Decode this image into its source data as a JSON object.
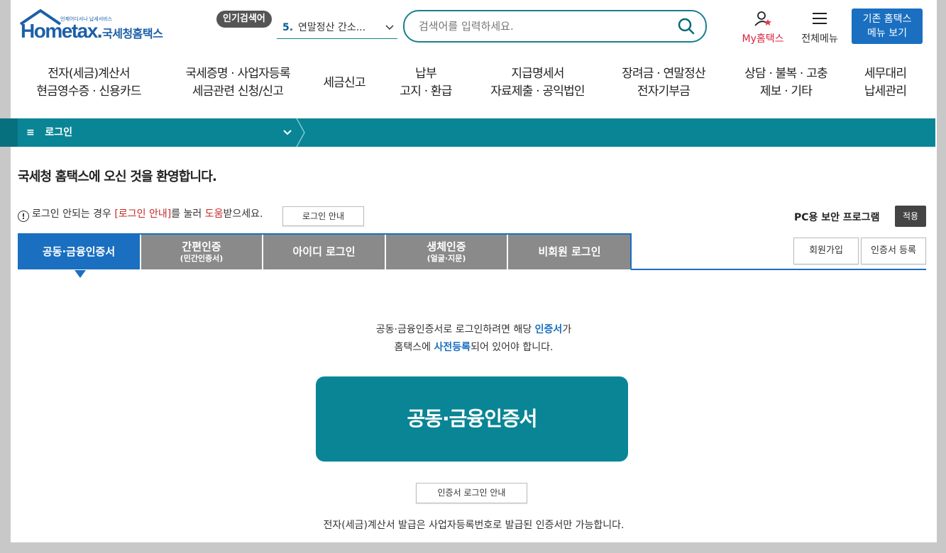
{
  "header": {
    "logo_small": "언제어디서나 납세서비스",
    "logo_brand": "Hometax.",
    "logo_kr": "국세청홈택스",
    "popular_badge": "인기검색어",
    "popular_num": "5.",
    "popular_text": "연말정산 간소...",
    "search_placeholder": "검색어를 입력하세요.",
    "my_label": "My홈택스",
    "all_menu_label": "전체메뉴",
    "old_btn_line1": "기존 홈택스",
    "old_btn_line2": "메뉴 보기"
  },
  "gnb": [
    {
      "l1": "전자(세금)계산서",
      "l2": "현금영수증 · 신용카드"
    },
    {
      "l1": "국세증명 · 사업자등록",
      "l2": "세금관련 신청/신고"
    },
    {
      "l1": "세금신고",
      "l2": ""
    },
    {
      "l1": "납부",
      "l2": "고지 · 환급"
    },
    {
      "l1": "지급명세서",
      "l2": "자료제출 · 공익법인"
    },
    {
      "l1": "장려금 · 연말정산",
      "l2": "전자기부금"
    },
    {
      "l1": "상담 · 불복 · 고충",
      "l2": "제보 · 기타"
    },
    {
      "l1": "세무대리",
      "l2": "납세관리"
    }
  ],
  "bar": {
    "crumb": "로그인"
  },
  "content": {
    "welcome": "국세청 홈택스에 오신 것을 환영합니다.",
    "help_pre": "로그인 안되는 경우 ",
    "help_red1": "[로그인 안내]",
    "help_mid": "를 눌러 ",
    "help_red2": "도움",
    "help_post": "받으세요.",
    "guide_btn": "로그인 안내",
    "pc_label": "PC용 보안 프로그램",
    "apply_btn": "적용",
    "tabs": [
      {
        "t1": "공동·금융인증서",
        "t2": ""
      },
      {
        "t1": "간편인증",
        "t2": "(민간인증서)"
      },
      {
        "t1": "아이디 로그인",
        "t2": ""
      },
      {
        "t1": "생체인증",
        "t2": "(얼굴·지문)"
      },
      {
        "t1": "비회원 로그인",
        "t2": ""
      }
    ],
    "join_btn": "회원가입",
    "cert_reg_btn": "인증서 등록",
    "desc1_pre": "공동·금융인증서로 로그인하려면 해당 ",
    "desc1_blue": "인증서",
    "desc1_post": "가",
    "desc2_pre": "홈택스에 ",
    "desc2_blue": "사전등록",
    "desc2_post": "되어 있어야 합니다.",
    "big_btn": "공동·금융인증서",
    "cert_guide_btn": "인증서 로그인 안내",
    "note": "전자(세금)계산서 발급은 사업자등록번호로 발급된 인증서만 가능합니다."
  },
  "colors": {
    "teal": "#0a8595",
    "blue": "#1a6fc0",
    "red": "#d9243d"
  }
}
